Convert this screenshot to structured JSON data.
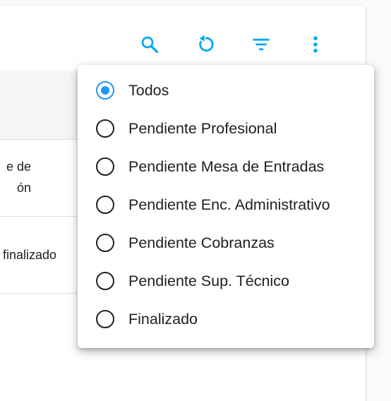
{
  "toolbar": {
    "icons": [
      "search-icon",
      "refresh-icon",
      "filter-icon",
      "more-vert-icon"
    ],
    "accent_color": "#03a9f4"
  },
  "table": {
    "rows": [
      {
        "text": "e de\nón"
      },
      {
        "text": "finalizado"
      }
    ]
  },
  "filter_menu": {
    "selected_index": 0,
    "accent_color": "#2196f3",
    "options": [
      {
        "label": "Todos",
        "checked": true
      },
      {
        "label": "Pendiente Profesional",
        "checked": false
      },
      {
        "label": "Pendiente Mesa de Entradas",
        "checked": false
      },
      {
        "label": "Pendiente Enc. Administrativo",
        "checked": false
      },
      {
        "label": "Pendiente Cobranzas",
        "checked": false
      },
      {
        "label": "Pendiente Sup. Técnico",
        "checked": false
      },
      {
        "label": "Finalizado",
        "checked": false
      }
    ]
  }
}
